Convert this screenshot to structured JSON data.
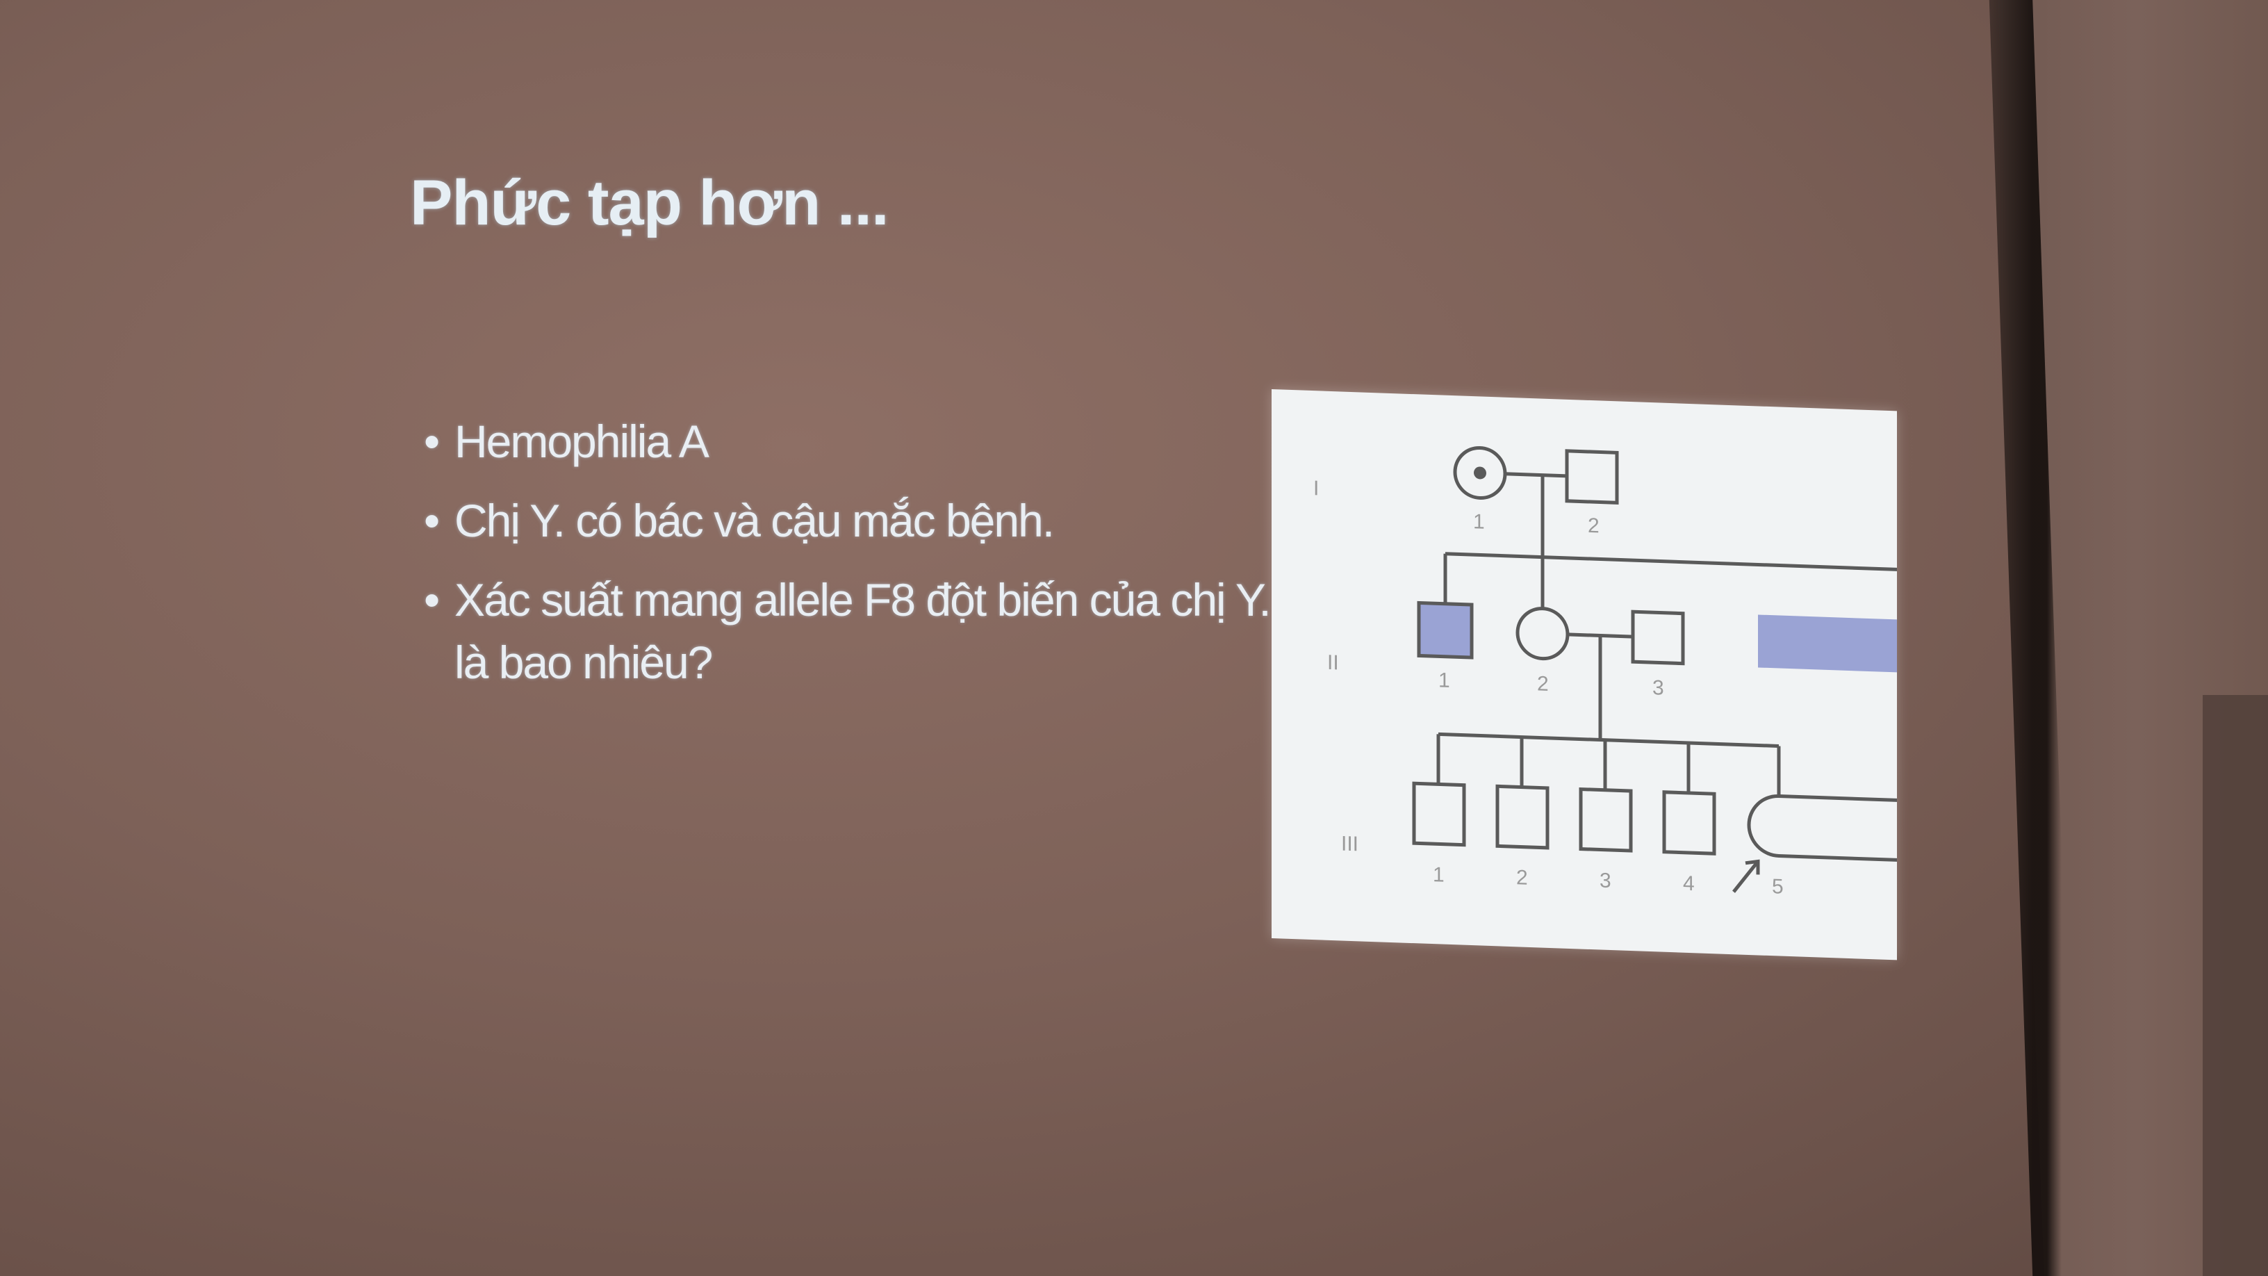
{
  "slide": {
    "title": "Phức tạp hơn ...",
    "bullets": [
      "Hemophilia A",
      "Chị Y. có bác và cậu mắc bệnh.",
      "Xác suất mang allele F8 đột biến của chị Y. là bao nhiêu?"
    ],
    "bullet_symbol": "•"
  },
  "pedigree": {
    "generation_labels": [
      "I",
      "II",
      "III"
    ],
    "gen1_numbers": [
      "1",
      "2"
    ],
    "gen2_numbers": [
      "1",
      "2",
      "3"
    ],
    "gen3_numbers": [
      "1",
      "2",
      "3",
      "4",
      "5"
    ],
    "colors": {
      "affected": "#9aa3d4",
      "line": "#5a5a5a",
      "panel": "#f1f3f4"
    }
  }
}
